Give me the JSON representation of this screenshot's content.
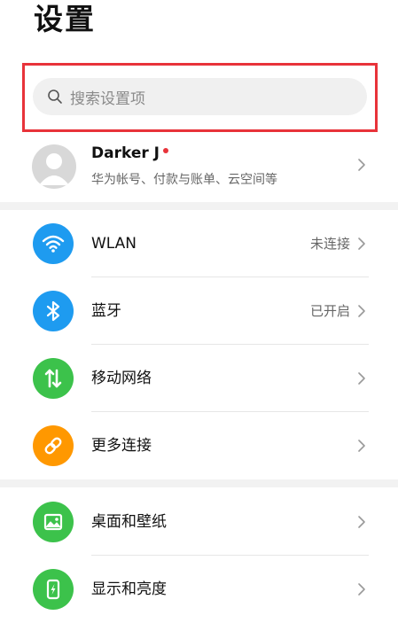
{
  "page": {
    "title": "设置"
  },
  "search": {
    "placeholder": "搜索设置项",
    "icon": "search-icon"
  },
  "account": {
    "name": "Darker J",
    "subtitle": "华为帐号、付款与账单、云空间等",
    "has_notification_dot": true,
    "notification_color": "#e8333a"
  },
  "groups": [
    {
      "items": [
        {
          "label": "WLAN",
          "status": "未连接",
          "icon": "wifi-icon",
          "color": "#1e9bf0"
        },
        {
          "label": "蓝牙",
          "status": "已开启",
          "icon": "bluetooth-icon",
          "color": "#1e9bf0"
        },
        {
          "label": "移动网络",
          "status": "",
          "icon": "mobile-network-icon",
          "color": "#3cc24b"
        },
        {
          "label": "更多连接",
          "status": "",
          "icon": "link-icon",
          "color": "#ff9800"
        }
      ]
    },
    {
      "items": [
        {
          "label": "桌面和壁纸",
          "status": "",
          "icon": "wallpaper-icon",
          "color": "#3cc24b"
        },
        {
          "label": "显示和亮度",
          "status": "",
          "icon": "display-brightness-icon",
          "color": "#3cc24b"
        }
      ]
    }
  ],
  "highlight_color": "#e8333a"
}
